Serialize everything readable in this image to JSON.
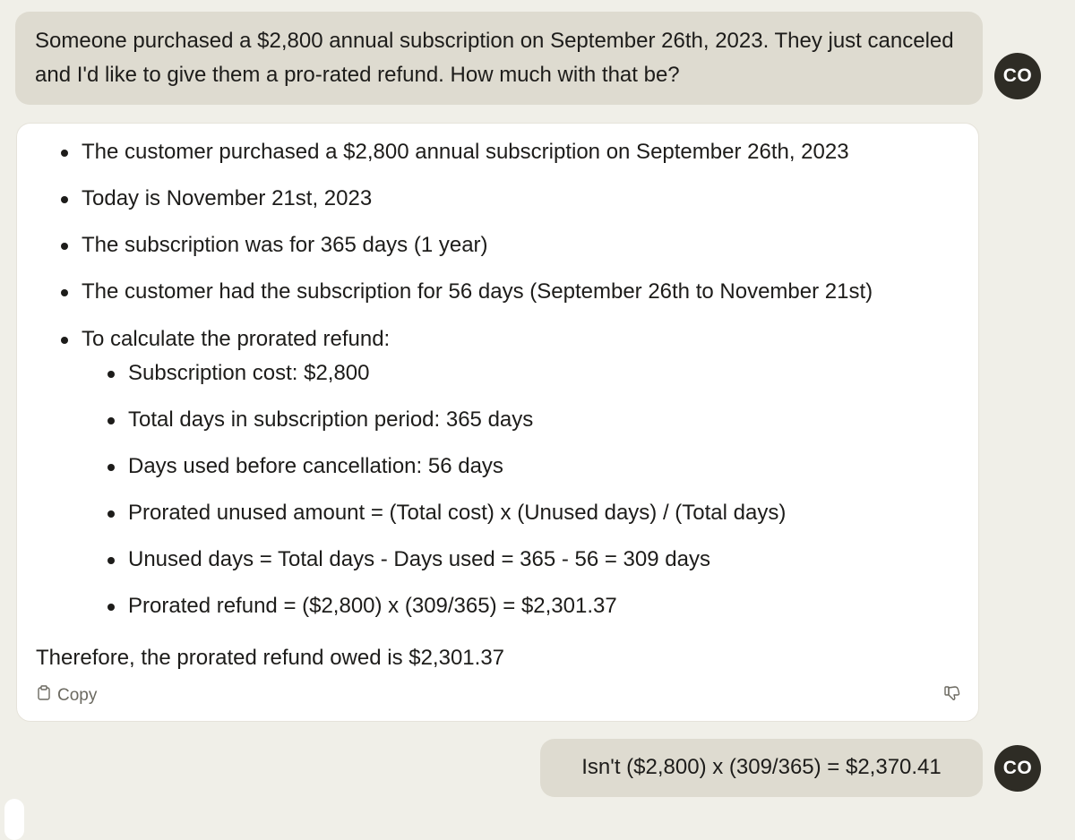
{
  "conversation": {
    "user_message_1": "Someone purchased a $2,800 annual subscription on September 26th, 2023. They just canceled and I'd like to give them a pro-rated refund. How much with that be?",
    "assistant": {
      "bullets": [
        "The customer purchased a $2,800 annual subscription on September 26th, 2023",
        "Today is November 21st, 2023",
        "The subscription was for 365 days (1 year)",
        "The customer had the subscription for 56 days (September 26th to November 21st)",
        "To calculate the prorated refund:"
      ],
      "sub_bullets": [
        "Subscription cost: $2,800",
        "Total days in subscription period: 365 days",
        "Days used before cancellation: 56 days",
        "Prorated unused amount = (Total cost) x (Unused days) / (Total days)",
        "Unused days = Total days - Days used = 365 - 56 = 309 days",
        "Prorated refund = ($2,800) x (309/365) = $2,301.37"
      ],
      "conclusion": "Therefore, the prorated refund owed is $2,301.37",
      "copy_label": "Copy"
    },
    "user_message_2": "Isn't ($2,800) x (309/365) = $2,370.41"
  },
  "user": {
    "avatar_initials": "CO"
  },
  "icons": {
    "copy": "clipboard-icon",
    "feedback": "thumbs-down-icon"
  },
  "colors": {
    "background": "#f0efe8",
    "user_bubble": "#dedbd0",
    "assistant_card": "#ffffff",
    "avatar": "#2e2c25",
    "muted_text": "#6b6960"
  }
}
